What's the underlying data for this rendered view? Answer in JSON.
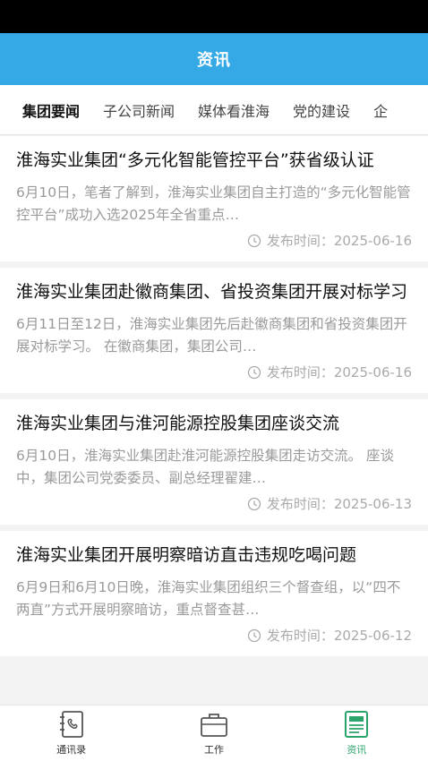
{
  "header": {
    "title": "资讯"
  },
  "tabs": [
    {
      "label": "集团要闻",
      "active": true
    },
    {
      "label": "子公司新闻",
      "active": false
    },
    {
      "label": "媒体看淮海",
      "active": false
    },
    {
      "label": "党的建设",
      "active": false
    },
    {
      "label": "企",
      "active": false
    }
  ],
  "news": [
    {
      "title": "淮海实业集团“多元化智能管控平台”获省级认证",
      "summary": "6月10日，笔者了解到，淮海实业集团自主打造的“多元化智能管控平台”成功入选2025年全省重点…",
      "date": "发布时间：2025-06-16"
    },
    {
      "title": "淮海实业集团赴徽商集团、省投资集团开展对标学习",
      "summary": "6月11日至12日，淮海实业集团先后赴徽商集团和省投资集团开展对标学习。 在徽商集团，集团公司…",
      "date": "发布时间：2025-06-16"
    },
    {
      "title": "淮海实业集团与淮河能源控股集团座谈交流",
      "summary": "6月10日，淮海实业集团赴淮河能源控股集团走访交流。 座谈中，集团公司党委委员、副总经理翟建…",
      "date": "发布时间：2025-06-13"
    },
    {
      "title": "淮海实业集团开展明察暗访直击违规吃喝问题",
      "summary": "6月9日和6月10日晚，淮海实业集团组织三个督查组，以“四不两直”方式开展明察暗访，重点督查甚…",
      "date": "发布时间：2025-06-12"
    }
  ],
  "bottom_nav": [
    {
      "label": "通讯录",
      "icon": "contacts-icon",
      "active": false
    },
    {
      "label": "工作",
      "icon": "briefcase-icon",
      "active": false
    },
    {
      "label": "资讯",
      "icon": "news-icon",
      "active": true
    }
  ],
  "colors": {
    "header": "#35a9e6",
    "active_nav": "#2aa46a"
  }
}
